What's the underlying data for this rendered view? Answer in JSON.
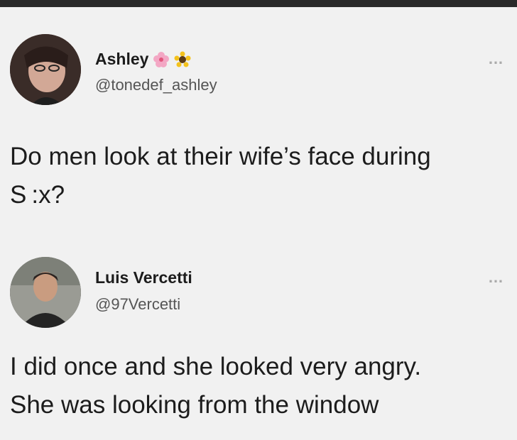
{
  "tweets": [
    {
      "name": "Ashley",
      "name_emojis": [
        "cherry-blossom-icon",
        "sunflower-icon"
      ],
      "handle": "@tonedef_ashley",
      "more": "…",
      "text": "Do men look at their wife’s face during\nS :x?"
    },
    {
      "name": "Luis Vercetti",
      "handle": "@97Vercetti",
      "more": "…",
      "text": "I did once and she looked very angry.\nShe was looking from the window"
    }
  ]
}
